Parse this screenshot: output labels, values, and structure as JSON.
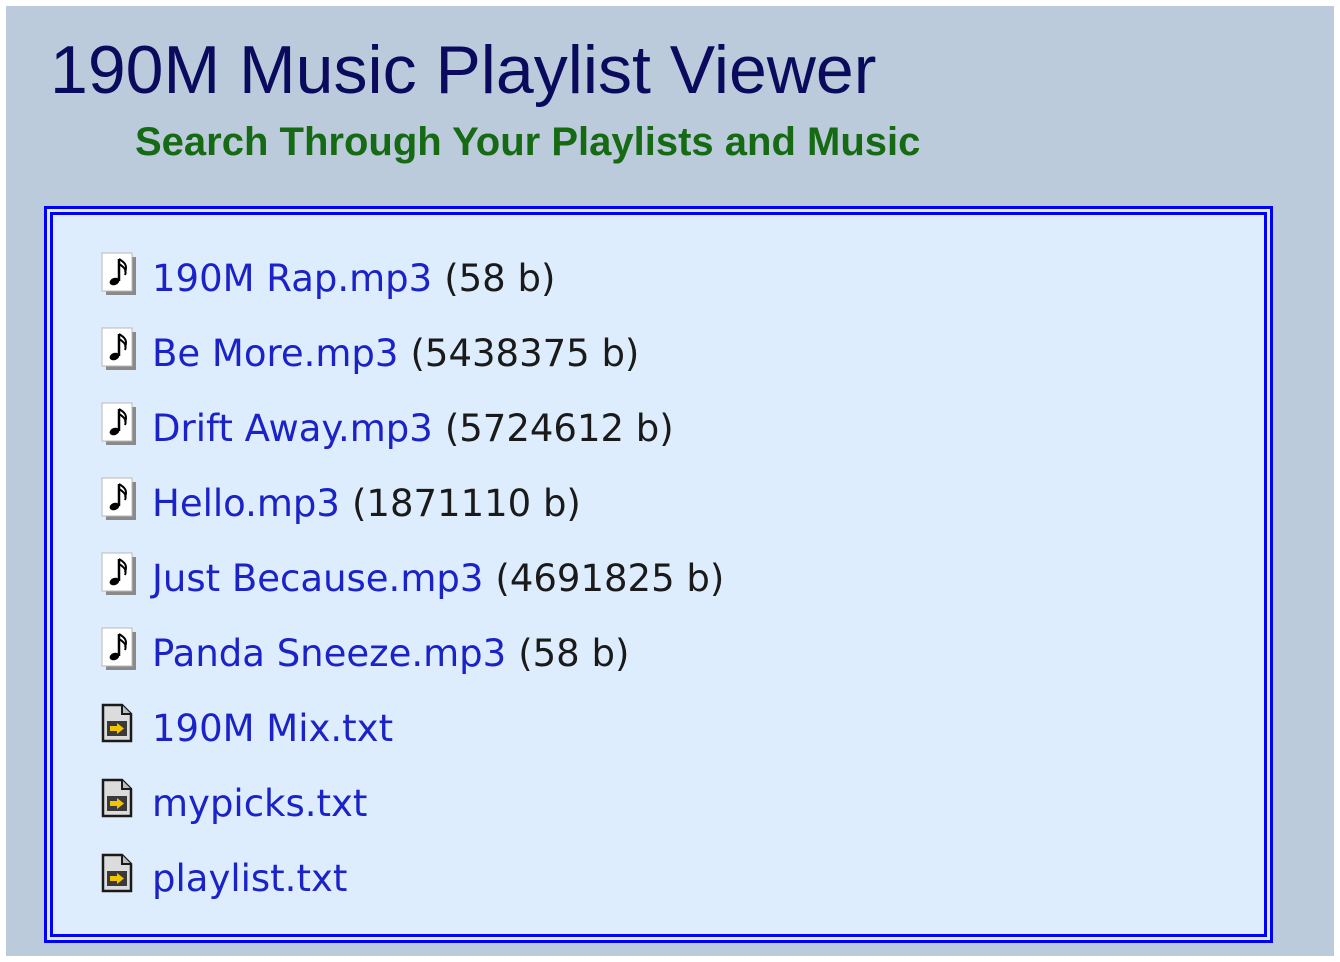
{
  "header": {
    "title": "190M Music Playlist Viewer",
    "subtitle": "Search Through Your Playlists and Music"
  },
  "colors": {
    "page_background": "#bccbdb",
    "panel_background": "#ddedfd",
    "panel_border": "#0000ff",
    "title": "#0b0b5e",
    "subtitle": "#166a14",
    "link": "#1a22c8"
  },
  "files": [
    {
      "name": "190M Rap.mp3",
      "size": "(58 b)",
      "icon": "music-note-icon"
    },
    {
      "name": "Be More.mp3",
      "size": "(5438375 b)",
      "icon": "music-note-icon"
    },
    {
      "name": "Drift Away.mp3",
      "size": "(5724612 b)",
      "icon": "music-note-icon"
    },
    {
      "name": "Hello.mp3",
      "size": "(1871110 b)",
      "icon": "music-note-icon"
    },
    {
      "name": "Just Because.mp3",
      "size": "(4691825 b)",
      "icon": "music-note-icon"
    },
    {
      "name": "Panda Sneeze.mp3",
      "size": "(58 b)",
      "icon": "music-note-icon"
    },
    {
      "name": "190M Mix.txt",
      "size": "",
      "icon": "playlist-file-icon"
    },
    {
      "name": "mypicks.txt",
      "size": "",
      "icon": "playlist-file-icon"
    },
    {
      "name": "playlist.txt",
      "size": "",
      "icon": "playlist-file-icon"
    }
  ]
}
